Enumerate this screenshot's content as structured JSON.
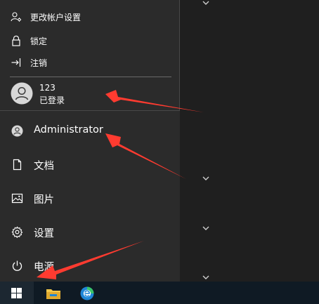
{
  "account_flyout": {
    "items": [
      {
        "label": "更改帐户设置",
        "icon": "user-settings-icon"
      },
      {
        "label": "锁定",
        "icon": "lock-icon"
      },
      {
        "label": "注销",
        "icon": "sign-out-icon"
      }
    ],
    "other_user": {
      "name": "123",
      "status": "已登录"
    }
  },
  "left_rail": {
    "items": [
      {
        "label": "Administrator",
        "icon": "user-avatar-icon"
      },
      {
        "label": "文档",
        "icon": "document-icon"
      },
      {
        "label": "图片",
        "icon": "pictures-icon"
      },
      {
        "label": "设置",
        "icon": "gear-icon"
      },
      {
        "label": "电源",
        "icon": "power-icon"
      }
    ]
  },
  "taskbar": {
    "items": [
      {
        "icon": "windows-start-icon"
      },
      {
        "icon": "file-explorer-icon"
      },
      {
        "icon": "edge-browser-icon"
      }
    ]
  },
  "colors": {
    "rail_background": "#2b2b2b",
    "tiles_background": "#1f1f1f",
    "taskbar_background": "#0f1a24",
    "annotation_arrow": "#ff3b30",
    "windows_logo": "#ffffff",
    "explorer_yellow": "#f2c74b",
    "edge_blue": "#1f86d6",
    "edge_green": "#39c46a"
  }
}
